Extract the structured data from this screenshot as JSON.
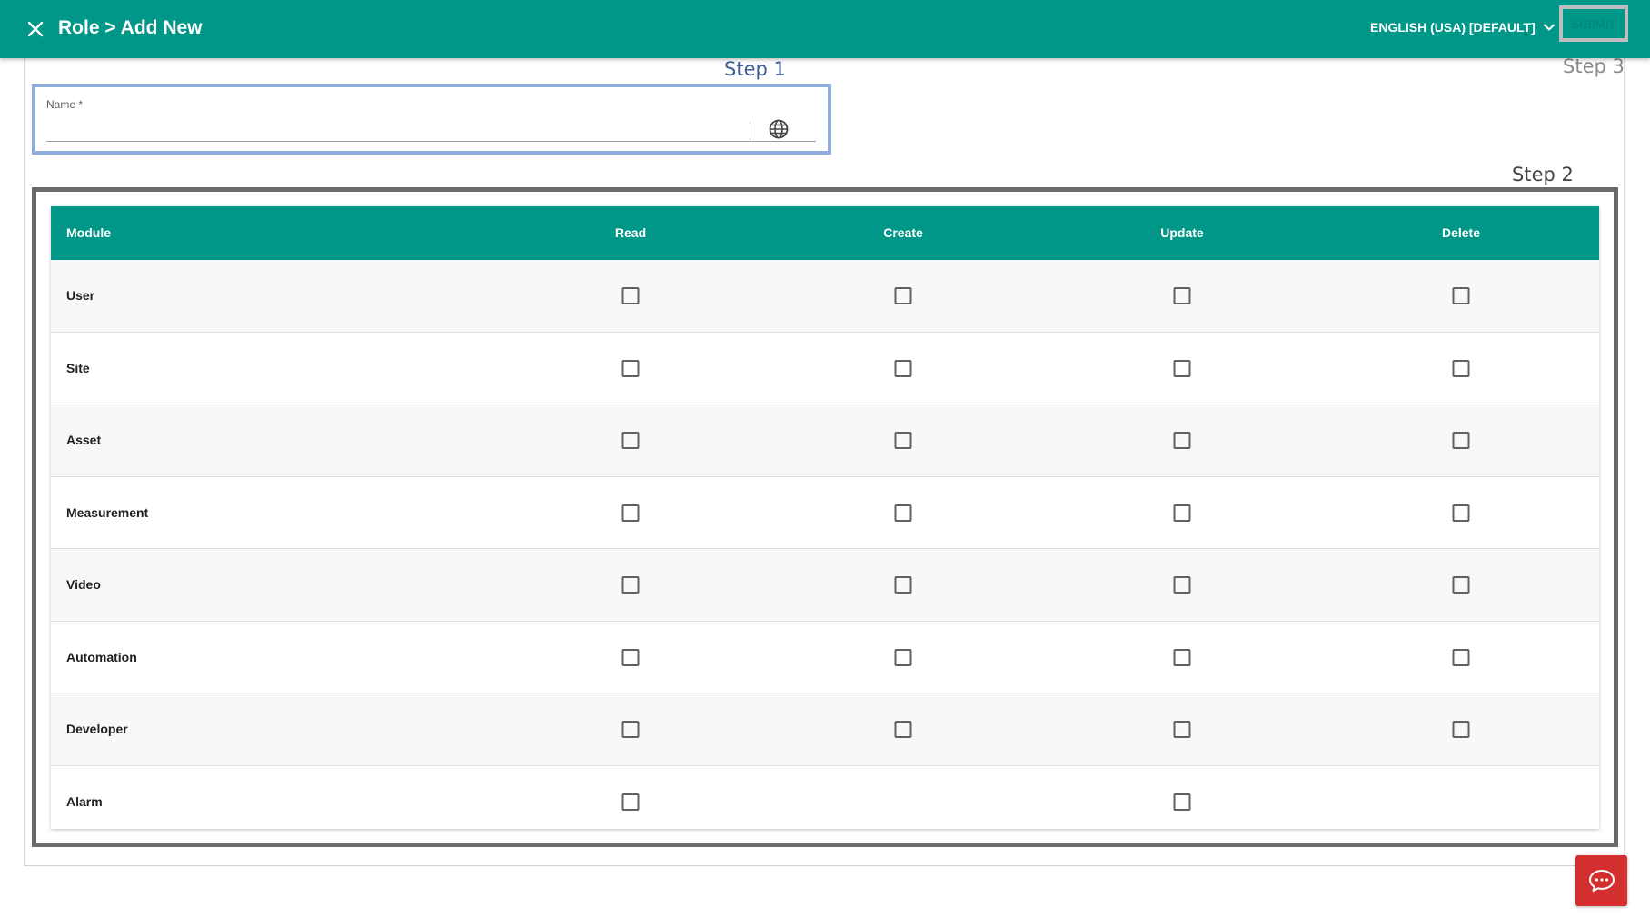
{
  "header": {
    "title": "Role > Add New",
    "language": "ENGLISH (USA) [DEFAULT]",
    "submit_label": "SUBMIT"
  },
  "annotations": {
    "step1": "Step 1",
    "step2": "Step 2",
    "step3": "Step 3"
  },
  "name_field": {
    "label": "Name *",
    "value": ""
  },
  "table": {
    "columns": [
      "Module",
      "Read",
      "Create",
      "Update",
      "Delete"
    ],
    "rows": [
      {
        "module": "User",
        "read": false,
        "create": false,
        "update": false,
        "delete": false
      },
      {
        "module": "Site",
        "read": false,
        "create": false,
        "update": false,
        "delete": false
      },
      {
        "module": "Asset",
        "read": false,
        "create": false,
        "update": false,
        "delete": false
      },
      {
        "module": "Measurement",
        "read": false,
        "create": false,
        "update": false,
        "delete": false
      },
      {
        "module": "Video",
        "read": false,
        "create": false,
        "update": false,
        "delete": false
      },
      {
        "module": "Automation",
        "read": false,
        "create": false,
        "update": false,
        "delete": false
      },
      {
        "module": "Developer",
        "read": false,
        "create": false,
        "update": false,
        "delete": false
      },
      {
        "module": "Alarm",
        "read": false,
        "create": null,
        "update": false,
        "delete": null
      }
    ]
  },
  "colors": {
    "primary": "#009688",
    "step1_highlight": "#8faddc",
    "step2_highlight": "#6b6b6b",
    "step3_highlight": "#bdbdbd",
    "chat_button": "#d32f2f"
  },
  "icons": {
    "close": "close-icon",
    "language_dropdown": "chevron-down-icon",
    "translate": "globe-icon",
    "chat": "chat-icon"
  }
}
